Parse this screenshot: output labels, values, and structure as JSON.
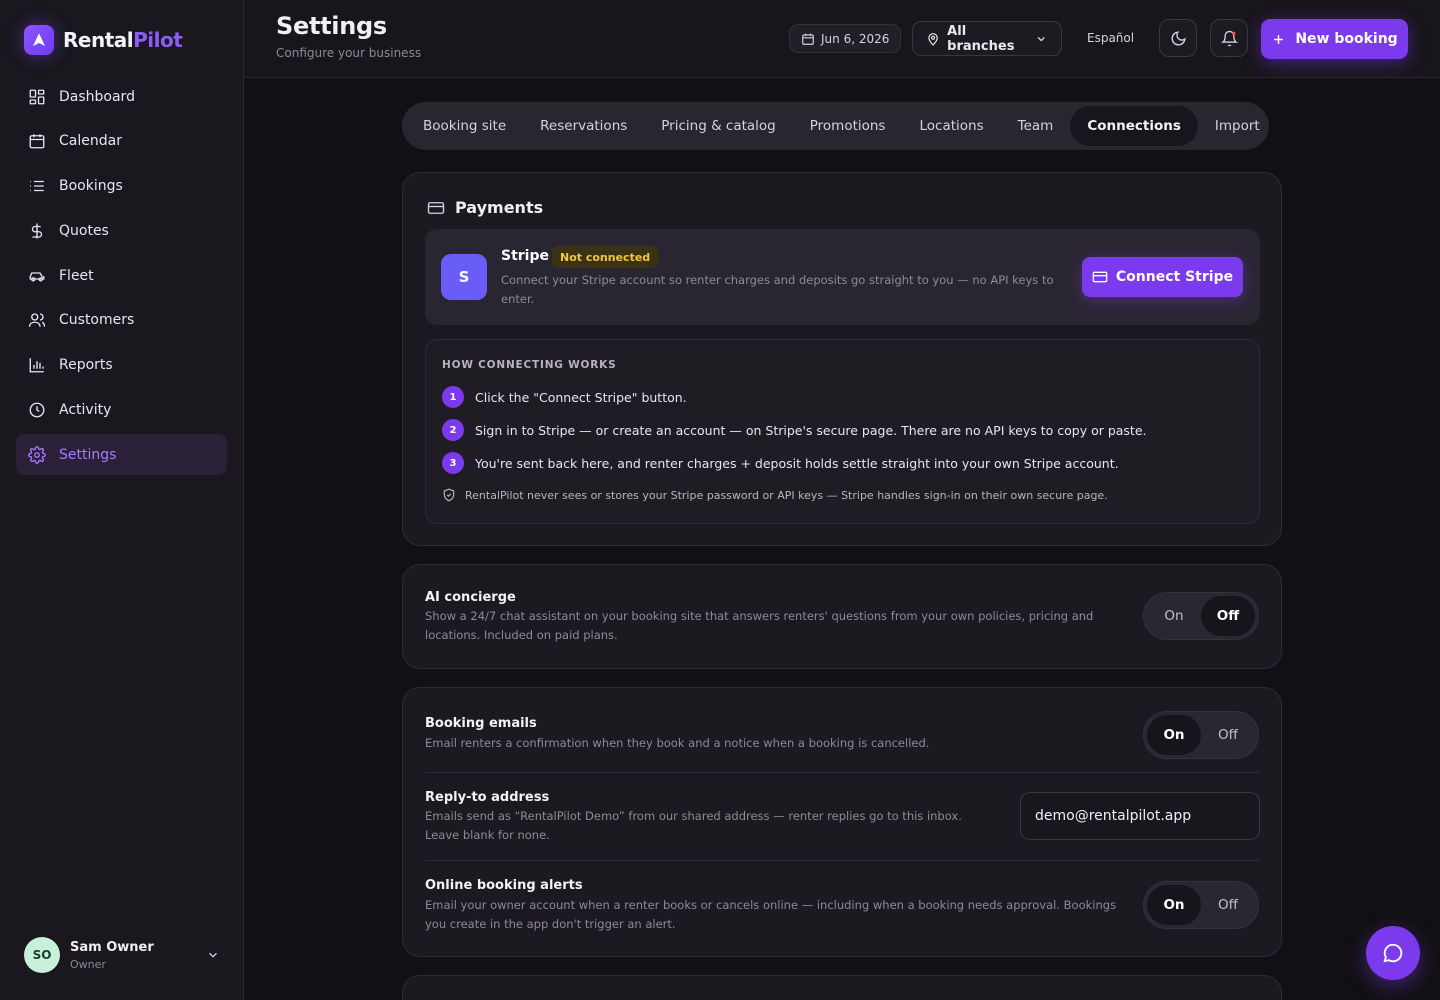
{
  "brand": {
    "name_a": "Rental",
    "name_b": "Pilot",
    "accent": "#7c3aed"
  },
  "sidebar": {
    "items": [
      {
        "label": "Dashboard",
        "icon": "dashboard-icon"
      },
      {
        "label": "Calendar",
        "icon": "calendar-icon"
      },
      {
        "label": "Bookings",
        "icon": "list-icon"
      },
      {
        "label": "Quotes",
        "icon": "dollar-icon"
      },
      {
        "label": "Fleet",
        "icon": "car-icon"
      },
      {
        "label": "Customers",
        "icon": "users-icon"
      },
      {
        "label": "Reports",
        "icon": "bar-chart-icon"
      },
      {
        "label": "Activity",
        "icon": "clock-icon"
      },
      {
        "label": "Settings",
        "icon": "gear-icon",
        "active": true
      }
    ],
    "user": {
      "initials": "SO",
      "name": "Sam Owner",
      "role": "Owner"
    }
  },
  "header": {
    "title": "Settings",
    "subtitle": "Configure your business",
    "date": "Jun 6, 2026",
    "branch": "All branches",
    "language": "Español",
    "new_booking": "New booking"
  },
  "tabs": [
    {
      "label": "Booking site"
    },
    {
      "label": "Reservations"
    },
    {
      "label": "Pricing & catalog"
    },
    {
      "label": "Promotions"
    },
    {
      "label": "Locations"
    },
    {
      "label": "Team"
    },
    {
      "label": "Connections",
      "active": true
    },
    {
      "label": "Import"
    }
  ],
  "payments": {
    "title": "Payments",
    "stripe": {
      "logo": "S",
      "name": "Stripe",
      "status": "Not connected",
      "description": "Connect your Stripe account so renter charges and deposits go straight to you — no API keys to enter.",
      "button": "Connect Stripe"
    },
    "how": {
      "title": "HOW CONNECTING WORKS",
      "steps": [
        {
          "num": "1",
          "text": "Click the \"Connect Stripe\" button."
        },
        {
          "num": "2",
          "text": "Sign in to Stripe — or create an account — on Stripe's secure page. There are no API keys to copy or paste."
        },
        {
          "num": "3",
          "text": "You're sent back here, and renter charges + deposit holds settle straight into your own Stripe account."
        }
      ],
      "note": "RentalPilot never sees or stores your Stripe password or API keys — Stripe handles sign-in on their own secure page."
    }
  },
  "toggle_labels": {
    "on": "On",
    "off": "Off"
  },
  "ai_concierge": {
    "title": "AI concierge",
    "description": "Show a 24/7 chat assistant on your booking site that answers renters' questions from your own policies, pricing and locations. Included on paid plans.",
    "state": "off"
  },
  "emails": {
    "booking_emails": {
      "title": "Booking emails",
      "description": "Email renters a confirmation when they book and a notice when a booking is cancelled.",
      "state": "on"
    },
    "reply_to": {
      "title": "Reply-to address",
      "description": "Emails send as “RentalPilot Demo” from our shared address — renter replies go to this inbox. Leave blank for none.",
      "value": "demo@rentalpilot.app"
    },
    "alerts": {
      "title": "Online booking alerts",
      "description": "Email your owner account when a renter books or cancels online — including when a booking needs approval. Bookings you create in the app don't trigger an alert.",
      "state": "on"
    }
  }
}
